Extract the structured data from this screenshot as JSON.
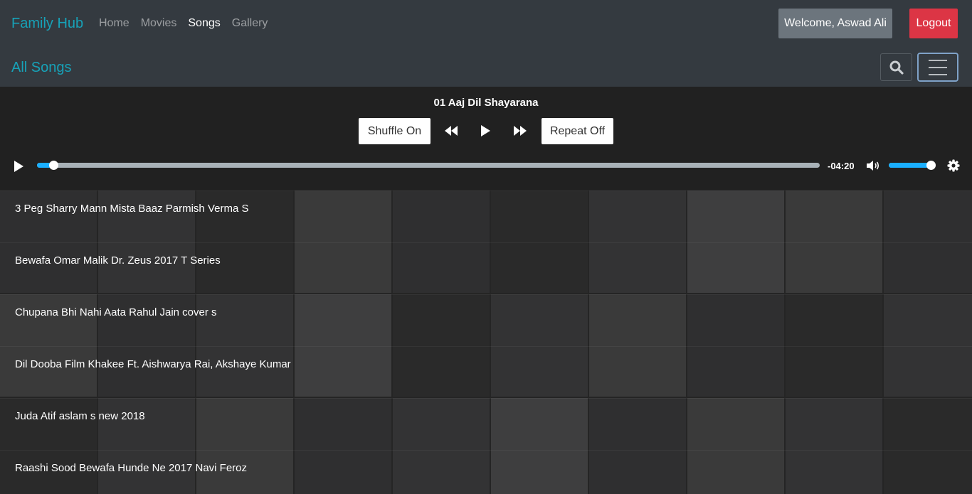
{
  "navbar": {
    "brand": "Family Hub",
    "links": [
      "Home",
      "Movies",
      "Songs",
      "Gallery"
    ],
    "active_link": "Songs",
    "welcome": "Welcome, Aswad Ali",
    "logout": "Logout",
    "page_heading": "All Songs",
    "search_icon": "search-icon",
    "menu_icon": "hamburger-icon"
  },
  "player": {
    "now_playing": "01 Aaj Dil Shayarana",
    "shuffle_label": "Shuffle On",
    "repeat_label": "Repeat Off",
    "time_remaining": "-04:20",
    "progress": 0.01,
    "volume": 1.0,
    "icons": [
      "rewind-icon",
      "play-icon",
      "fast-forward-icon",
      "volume-icon",
      "settings-icon"
    ]
  },
  "songs": [
    "3 Peg Sharry Mann Mista Baaz Parmish Verma S",
    "Bewafa Omar Malik Dr. Zeus 2017 T Series",
    "Chupana Bhi Nahi Aata Rahul Jain cover s",
    "Dil Dooba Film Khakee Ft. Aishwarya Rai, Akshaye Kumar",
    "Juda Atif aslam s new 2018",
    "Raashi Sood Bewafa Hunde Ne 2017 Navi Feroz"
  ],
  "colors": {
    "accent": "#17a2b8",
    "navbar_bg": "#343a40",
    "logout_bg": "#dc3545",
    "welcome_bg": "#6c757d",
    "progress_fill": "#1aafff",
    "player_bg": "#212121"
  }
}
